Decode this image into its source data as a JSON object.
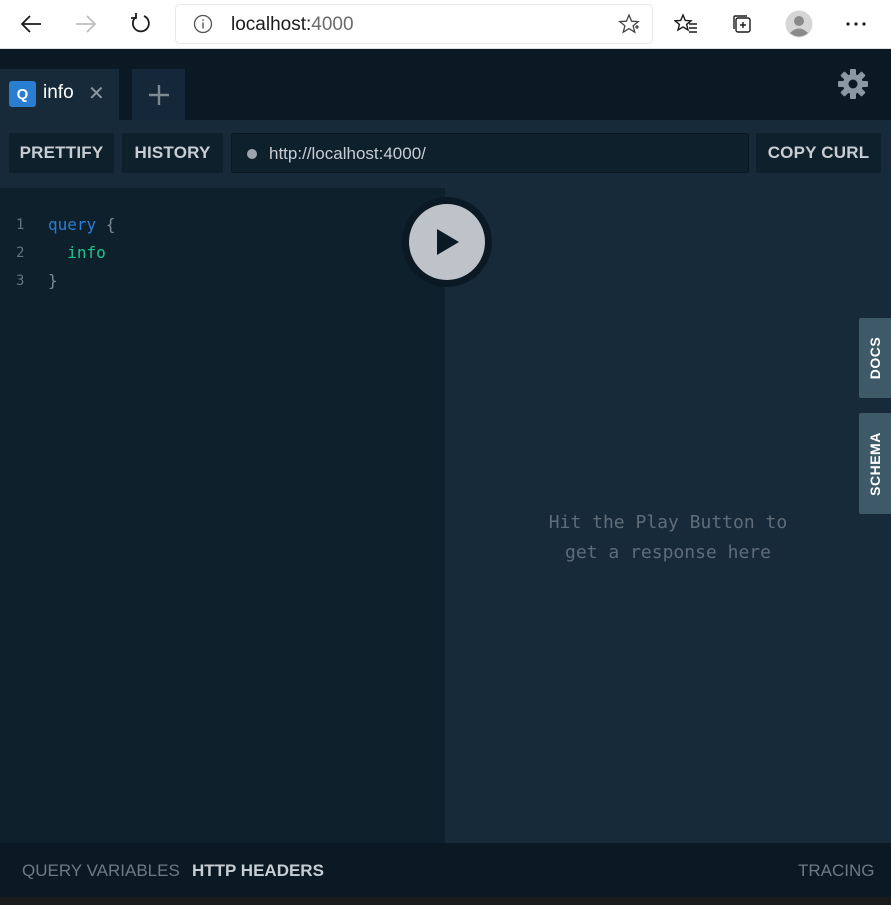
{
  "browser": {
    "address_host": "localhost:",
    "address_port": "4000"
  },
  "playground": {
    "tab": {
      "badge": "Q",
      "title": "info",
      "close": "✕"
    },
    "add_tab": "+",
    "toolbar": {
      "prettify": "PRETTIFY",
      "history": "HISTORY",
      "endpoint": "http://localhost:4000/",
      "copy_curl": "COPY CURL"
    },
    "editor": {
      "lines": [
        {
          "number": "1",
          "keyword": "query",
          "rest": " {"
        },
        {
          "number": "2",
          "field": "  info"
        },
        {
          "number": "3",
          "brace": "}"
        }
      ]
    },
    "result": {
      "line1": "Hit the Play Button to",
      "line2": "get a response here"
    },
    "side_tabs": {
      "docs": "DOCS",
      "schema": "SCHEMA"
    },
    "bottom": {
      "query_variables": "QUERY VARIABLES",
      "http_headers": "HTTP HEADERS",
      "tracing": "TRACING"
    }
  },
  "colors": {
    "accent": "#2a7ed2",
    "field": "#1ec48a",
    "editor_bg": "#0f202d",
    "result_bg": "#172a3a"
  }
}
